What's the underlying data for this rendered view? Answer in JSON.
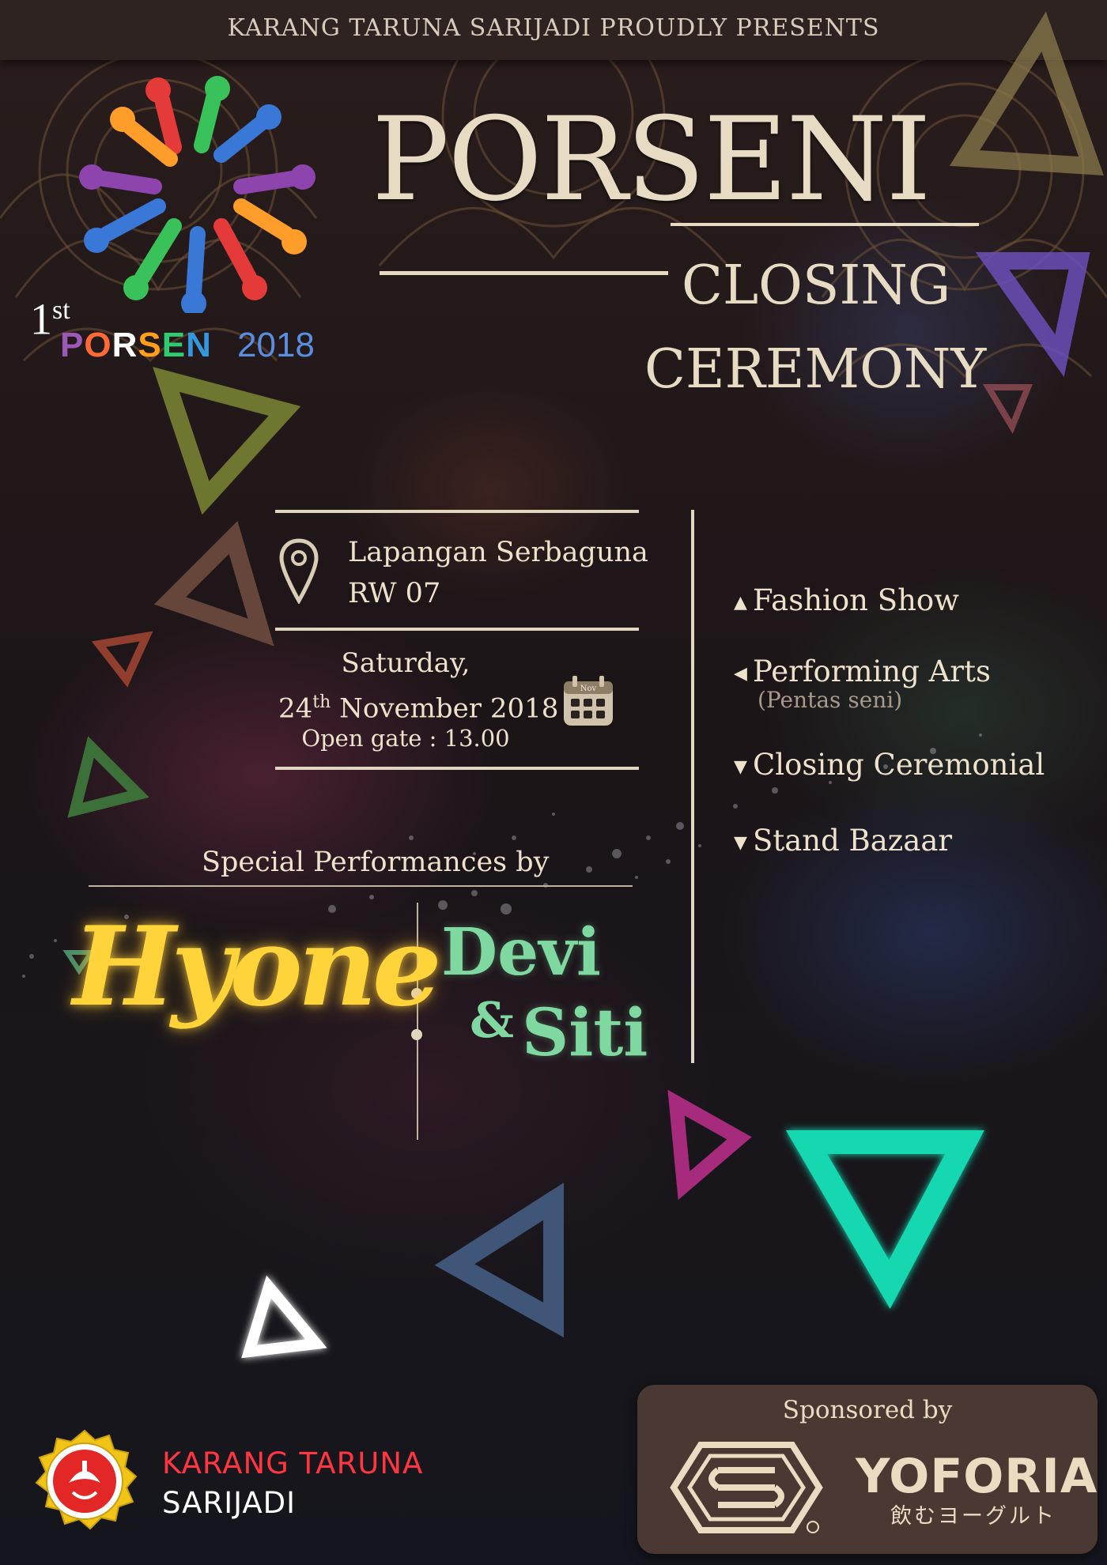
{
  "header": {
    "presenter": "KARANG TARUNA SARIJADI PROUDLY PRESENTS"
  },
  "event_logo": {
    "edition": "1",
    "edition_suffix": "st",
    "name": "PORSEN",
    "year": "2018",
    "name_letter_colors": [
      "#9b59b6",
      "#ff6b35",
      "#ffffff",
      "#ff9f1c",
      "#2ecc71",
      "#3498db",
      "#9b59b6"
    ]
  },
  "title": {
    "main": "PORSENI",
    "line1": "CLOSING",
    "line2": "CEREMONY"
  },
  "details": {
    "venue_line1": "Lapangan Serbaguna",
    "venue_line2": "RW 07",
    "day": "Saturday,",
    "date_day": "24",
    "date_suffix": "th",
    "date_rest": "November 2018",
    "open_gate": "Open gate : 13.00",
    "calendar_month": "Nov"
  },
  "agenda": [
    {
      "label": "Fashion Show",
      "marker": "▲"
    },
    {
      "label": "Performing Arts",
      "sub": "(Pentas seni)",
      "marker": "◀"
    },
    {
      "label": "Closing Ceremonial",
      "marker": "▼"
    },
    {
      "label": "Stand Bazaar",
      "marker": "▼"
    }
  ],
  "special": {
    "title": "Special Performances by",
    "performer1": "Hyone",
    "performer2_a": "Devi",
    "performer2_amp": "&",
    "performer2_b": "Siti"
  },
  "sponsors": {
    "title": "Sponsored by",
    "sponsor2_name": "YOFORIA",
    "sponsor2_tagline": "飲むヨーグルト"
  },
  "organizer": {
    "name_line1": "KARANG TARUNA",
    "name_line2": "SARIJADI"
  },
  "colors": {
    "cream": "#e7dcc3",
    "hyone_yellow": "#ffd43a",
    "devi_green": "#7fd8a0",
    "org_red": "#ff3640",
    "teal_triangle": "#18d8b0"
  }
}
